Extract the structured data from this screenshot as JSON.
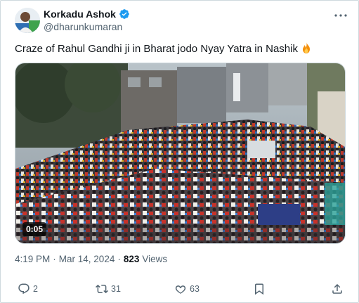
{
  "author": {
    "display_name": "Korkadu Ashok",
    "handle": "@dharunkumaran",
    "verified": true
  },
  "tweet": {
    "text": "Craze of Rahul Gandhi ji in Bharat jodo Nyay Yatra in Nashik",
    "emoji": "fire-icon"
  },
  "media": {
    "duration": "0:05",
    "kind": "video"
  },
  "meta": {
    "time": "4:19 PM",
    "separator": "·",
    "date": "Mar 14, 2024",
    "views_count": "823",
    "views_label": "Views"
  },
  "actions": {
    "replies": "2",
    "reposts": "31",
    "likes": "63"
  },
  "colors": {
    "verified_blue": "#1d9bf0",
    "secondary_text": "#536471",
    "primary_text": "#0f1419"
  }
}
